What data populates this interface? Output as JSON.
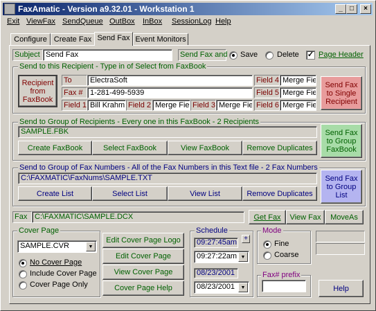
{
  "window": {
    "title": "FaxAmatic - Version a9.32.01 - Workstation 1",
    "controls": {
      "minimize": "_",
      "maximize": "□",
      "close": "×"
    }
  },
  "menu": {
    "items": [
      {
        "label": "Exit",
        "accel": "E"
      },
      {
        "label": "ViewFax",
        "accel": "F"
      },
      {
        "label": "SendQueue",
        "accel": "S"
      },
      {
        "label": "OutBox",
        "accel": "O"
      },
      {
        "label": "InBox",
        "accel": "I"
      },
      {
        "label": "SessionLog",
        "accel": "L"
      },
      {
        "label": "Help",
        "accel": "H"
      }
    ]
  },
  "tabs": [
    "Configure",
    "Create Fax",
    "Send Fax",
    "Event Monitors"
  ],
  "active_tab": "Send Fax",
  "subject": {
    "label": "Subject",
    "value": "Send Fax"
  },
  "send_fax_and": {
    "label": "Send Fax and",
    "save": "Save",
    "delete": "Delete",
    "selected": "Save"
  },
  "page_header": {
    "label": "Page Header",
    "checked": true
  },
  "recipient": {
    "title": "Send to this Recipient - Type in of Select from FaxBook",
    "recipient_button": "Recipient from FaxBook",
    "to_label": "To",
    "to_value": "ElectraSoft",
    "fax_label": "Fax #",
    "fax_value": "1-281-499-5939",
    "field1_label": "Field 1",
    "field1_value": "Bill Krahm",
    "field2_label": "Field 2",
    "field2_value": "Merge Fiel",
    "field3_label": "Field 3",
    "field3_value": "Merge Fiel",
    "field4_label": "Field 4",
    "field4_value": "Merge Fiel",
    "field5_label": "Field 5",
    "field5_value": "Merge Fiel",
    "field6_label": "Field 6",
    "field6_value": "Merge Fiel",
    "send_button": "Send Fax to Single Recipient"
  },
  "group_recipients": {
    "title": "Send to Group of Recipients - Every one in this FaxBook - 2 Recipients",
    "file": "SAMPLE.FBK",
    "buttons": [
      "Create FaxBook",
      "Select FaxBook",
      "View FaxBook",
      "Remove Duplicates"
    ],
    "send_button": "Send Fax to Group FaxBook"
  },
  "group_numbers": {
    "title": "Send to Group of Fax Numbers - All of the Fax Numbers in this Text file - 2 Fax Numbers",
    "file": "C:\\FAXMATIC\\FaxNums\\SAMPLE.TXT",
    "buttons": [
      "Create List",
      "Select List",
      "View List",
      "Remove Duplicates"
    ],
    "send_button": "Send Fax to Group List"
  },
  "fax": {
    "label": "Fax",
    "file": "C:\\FAXMATIC\\SAMPLE.DCX",
    "get": "Get Fax",
    "view": "View Fax",
    "move": "MoveAs"
  },
  "cover_page": {
    "title": "Cover Page",
    "selected": "SAMPLE.CVR",
    "options": [
      "No Cover Page",
      "Include Cover Page",
      "Cover Page Only"
    ],
    "selected_option": "No Cover Page",
    "buttons": [
      "Edit Cover Page Logo",
      "Edit Cover Page",
      "View Cover Page",
      "Cover Page Help"
    ]
  },
  "schedule": {
    "title": "Schedule",
    "time_display": "09:27:45am",
    "time_value": "09:27:22am",
    "date_display": "08/23/2001",
    "date_value": "08/23/2001",
    "plus": "+"
  },
  "mode": {
    "title": "Mode",
    "options": [
      "Fine",
      "Coarse"
    ],
    "selected": "Fine"
  },
  "fax_prefix": {
    "title": "Fax# prefix",
    "value": ""
  },
  "help_button": "Help",
  "icons": {
    "dropdown": "▼",
    "app": "app-icon"
  }
}
